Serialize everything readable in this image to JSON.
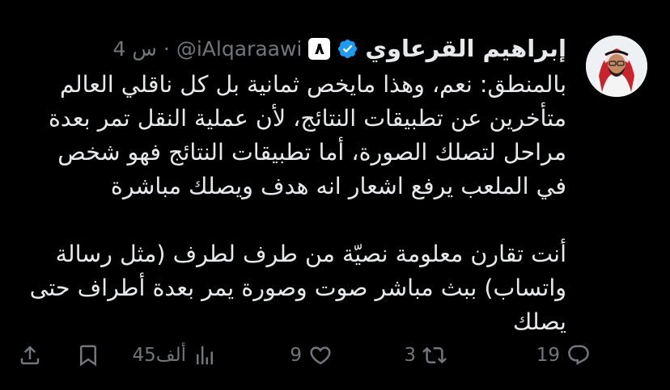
{
  "tweet": {
    "author_name": "إبراهيم القرعاوي",
    "affiliation_badge": "٨",
    "handle": "@iAlqaraawi",
    "separator": "·",
    "time": "4 س",
    "verified": true,
    "body_lines": [
      "بالمنطق: نعم، وهذا مايخص ثمانية بل كل ناقلي العالم",
      "متأخرين عن تطبيقات النتائج، لأن عملية النقل تمر بعدة",
      "مراحل لتصلك الصورة، أما تطبيقات النتائج فهو شخص",
      "في الملعب يرفع اشعار انه هدف ويصلك مباشرة"
    ],
    "body_lines_2": [
      "أنت تقارن معلومة نصيّة من طرف لطرف (مثل رسالة",
      "واتساب) ببث مباشر صوت وصورة يمر بعدة أطراف حتى",
      "يصلك"
    ]
  },
  "actions": {
    "replies": "19",
    "retweets": "3",
    "likes": "9",
    "views": "45ألف"
  },
  "colors": {
    "background": "#000000",
    "text": "#e7e9ea",
    "secondary": "#71767b",
    "verified": "#1d9bf0"
  },
  "icons": [
    "reply-icon",
    "retweet-icon",
    "like-icon",
    "views-icon",
    "bookmark-icon",
    "share-icon",
    "verified-icon"
  ]
}
